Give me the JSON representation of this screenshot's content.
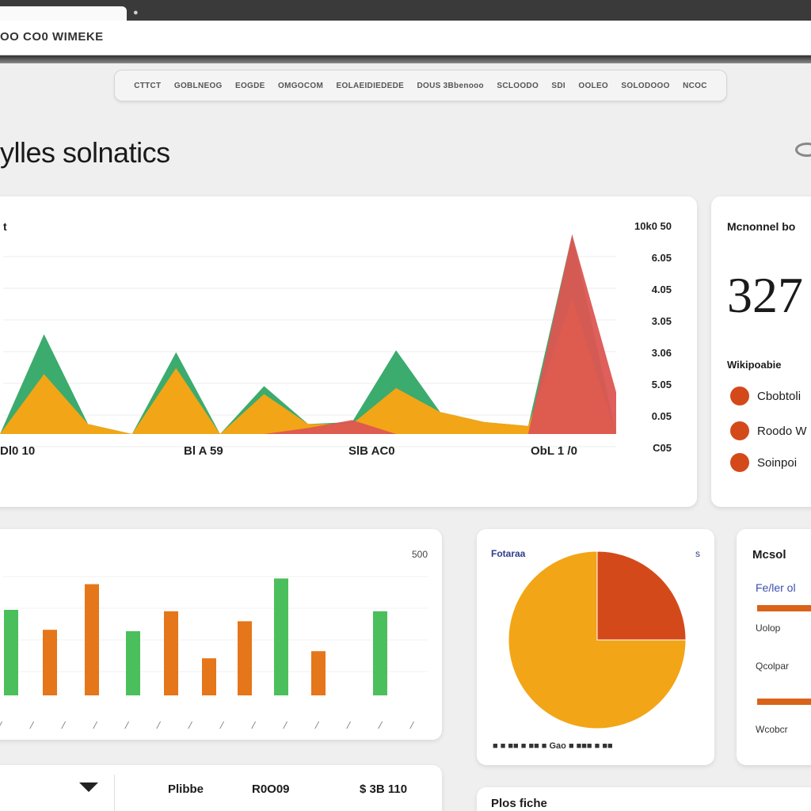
{
  "browser": {
    "address": "OO CO0 WIMEKE"
  },
  "nav": {
    "items": [
      "CTTCT",
      "GOBLNEOG",
      "EOGDE",
      "OMGOCOM",
      "EOLAEIDIEDEDE",
      "DOUS 3Bbenooo",
      "SCLOODO",
      "SDI",
      "OOLEO",
      "SOLODOOO",
      "NCOC"
    ]
  },
  "page": {
    "title": "ylles solnatics"
  },
  "area_card": {
    "label": "t",
    "x_ticks": [
      "Dl0 10",
      "Bl A 59",
      "SlB AC0",
      "ObL 1 /0"
    ],
    "y_ticks": [
      "10k0 50",
      "6.05",
      "4.05",
      "3.05",
      "3.06",
      "5.05",
      "0.05",
      "C05"
    ]
  },
  "metric_card": {
    "label": "Mcnonnel bo",
    "value": "327",
    "sub_label": "Wikipoabie",
    "rows": [
      "Cbobtoli",
      "Roodo W",
      "Soinpoi"
    ]
  },
  "bar_card": {
    "corner_label": "500",
    "x_ticks": [
      "",
      "",
      "",
      "",
      "",
      "",
      "",
      "",
      "",
      ""
    ]
  },
  "pie_card": {
    "label": "Fotaraa",
    "corner_label": "s",
    "legend": "■ ■ ■■ ■ ■■ ■ Gao ■ ■■■ ■ ■■"
  },
  "progress_card": {
    "title": "Mcsol",
    "link": "Fe/ler ol",
    "items": [
      {
        "text": "Uolop",
        "progress": 1.0
      },
      {
        "text": "Qcolpar",
        "progress": 1.0
      }
    ],
    "footer": "Wcobcr"
  },
  "bottom_card": {
    "col1": "Plibbe",
    "col2": "R0O09",
    "col3": "$ 3B 110"
  },
  "bottom_right_card": {
    "label": "Plos fiche"
  },
  "colors": {
    "green": "#3cab6e",
    "orange": "#f2a516",
    "red": "#dc5652",
    "deep_orange": "#d4491a",
    "bar_green": "#4bbf5b",
    "bar_orange": "#e5761a"
  },
  "chart_data": [
    {
      "type": "area",
      "title": "",
      "x": [
        "Dl0 10",
        "Bl A 59",
        "SlB AC0",
        "ObL 1 /0"
      ],
      "series": [
        {
          "values": [
            0,
            5.0,
            0.5,
            0,
            4.1,
            0,
            2.4,
            0.5,
            0.6,
            4.2,
            1.1,
            0.6,
            0.4,
            10.0,
            0
          ]
        },
        {
          "values": [
            0,
            3.0,
            0.5,
            0,
            3.3,
            0,
            2.0,
            0.5,
            0.5,
            2.3,
            1.1,
            0.6,
            0.4,
            6.8,
            0
          ]
        },
        {
          "values": [
            0,
            0,
            0,
            0,
            0,
            0,
            0,
            0.3,
            0.7,
            0,
            0,
            0,
            0,
            10.0,
            2.1
          ]
        }
      ]
    },
    {
      "type": "bar",
      "title": "",
      "values": [
        60,
        46,
        78,
        45,
        59,
        26,
        52,
        82,
        31,
        59
      ],
      "series": [
        {
          "values": [
            60,
            0,
            0,
            45,
            0,
            0,
            0,
            82,
            0,
            59
          ]
        },
        {
          "values": [
            0,
            46,
            78,
            0,
            59,
            26,
            52,
            0,
            31,
            0
          ]
        }
      ]
    },
    {
      "type": "pie",
      "title": "",
      "values": [
        75,
        25
      ]
    }
  ]
}
